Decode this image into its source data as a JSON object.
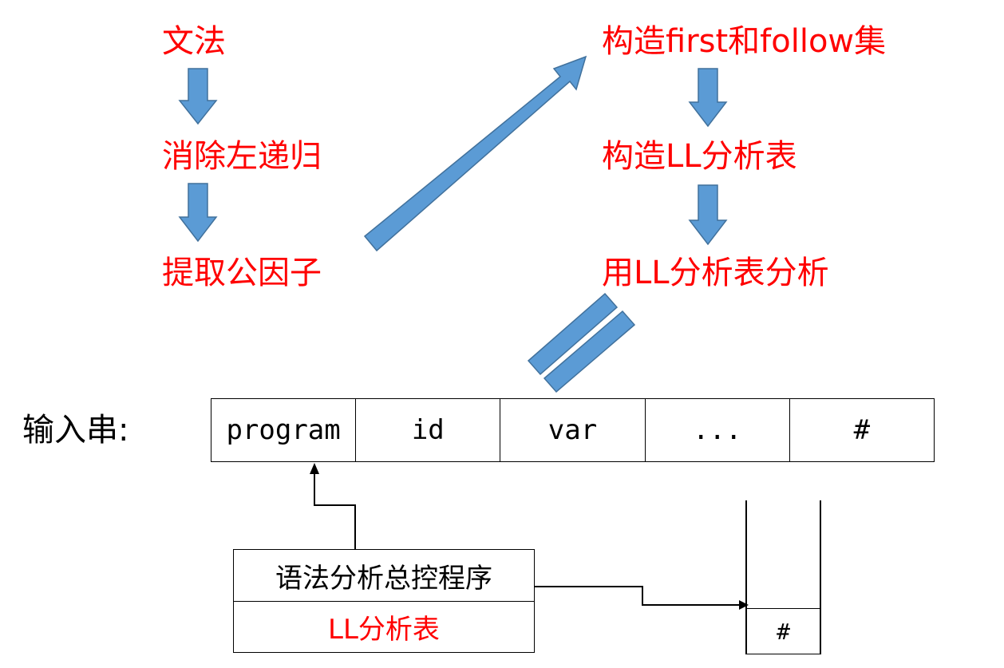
{
  "steps": {
    "grammar": "文法",
    "eliminate_left_recursion": "消除左递归",
    "extract_common_factor": "提取公因子",
    "build_first_follow": "构造first和follow集",
    "build_ll_table": "构造LL分析表",
    "analyze_with_table": "用LL分析表分析"
  },
  "input": {
    "label": "输入串:",
    "cells": [
      "program",
      "id",
      "var",
      "...",
      "#"
    ]
  },
  "controller": {
    "title": "语法分析总控程序",
    "table_label": "LL分析表"
  },
  "stack": {
    "bottom_symbol": "#"
  },
  "colors": {
    "step_text": "#ff0000",
    "arrow_fill": "#5b9bd5",
    "arrow_stroke": "#41719c",
    "line": "#000000"
  }
}
